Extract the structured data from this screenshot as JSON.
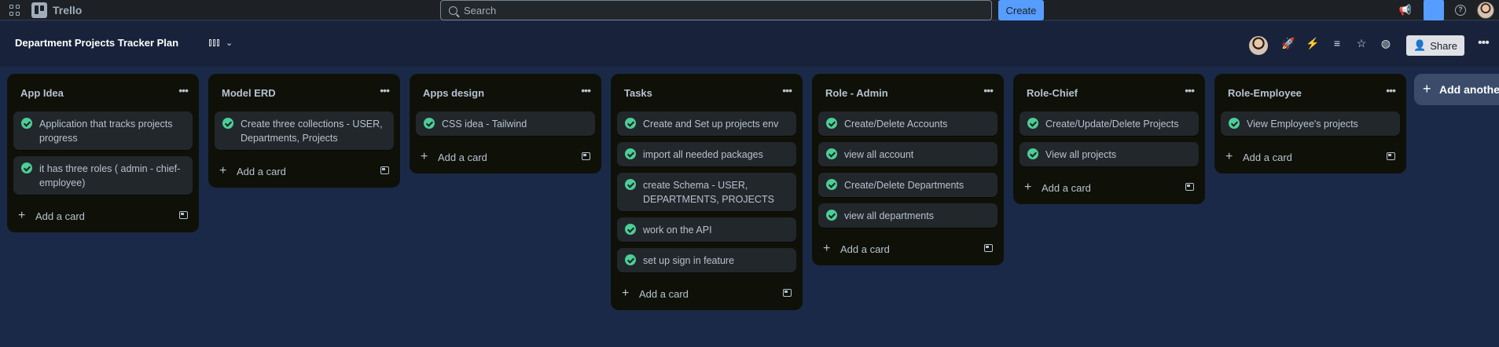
{
  "topbar": {
    "app_name": "Trello",
    "search_placeholder": "Search",
    "create_label": "Create",
    "icons": [
      "apps-grid-icon",
      "trello-logo-icon",
      "search-icon",
      "megaphone-icon",
      "notification-icon",
      "help-icon",
      "avatar"
    ]
  },
  "board": {
    "title": "Department Projects Tracker Plan",
    "share_label": "Share",
    "header_icons": [
      "board-view-icon",
      "chevron-down-icon",
      "rocket-icon",
      "lightning-icon",
      "filter-icon",
      "star-icon",
      "globe-icon",
      "more-icon"
    ]
  },
  "lists": [
    {
      "title": "App Idea",
      "cards": [
        "Application that tracks projects progress",
        "it has three roles ( admin - chief-employee)"
      ],
      "add_label": "Add a card"
    },
    {
      "title": "Model ERD",
      "cards": [
        "Create three collections - USER, Departments, Projects"
      ],
      "add_label": "Add a card"
    },
    {
      "title": "Apps design",
      "cards": [
        "CSS idea - Tailwind"
      ],
      "add_label": "Add a card"
    },
    {
      "title": "Tasks",
      "cards": [
        "Create and Set up projects env",
        "import all needed packages",
        "create Schema - USER, DEPARTMENTS, PROJECTS",
        "work on the API",
        "set up sign in feature"
      ],
      "add_label": "Add a card"
    },
    {
      "title": "Role - Admin",
      "cards": [
        "Create/Delete Accounts",
        "view all account",
        "Create/Delete Departments",
        "view all departments"
      ],
      "add_label": "Add a card"
    },
    {
      "title": "Role-Chief",
      "cards": [
        "Create/Update/Delete Projects",
        "View all projects"
      ],
      "add_label": "Add a card"
    },
    {
      "title": "Role-Employee",
      "cards": [
        "View Employee's projects"
      ],
      "add_label": "Add a card"
    }
  ],
  "add_another_label": "Add another",
  "colors": {
    "accent": "#579dff",
    "complete_check": "#4bce97",
    "list_bg": "#0f1108",
    "card_bg": "#22272b",
    "board_bg": "#1a2947"
  }
}
